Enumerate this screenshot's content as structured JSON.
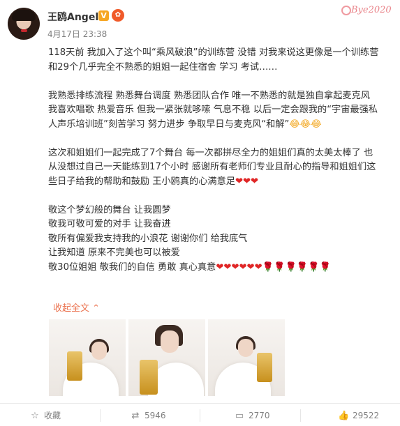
{
  "header": {
    "username": "王鸥Angel",
    "verified_badge": "V",
    "vip_icon": "✿",
    "date": "4月17日 23:38",
    "watermark_text": "Bye2020"
  },
  "post": {
    "paragraphs": [
      [
        "118天前 我加入了这个叫“乘风破浪”的训练营 没错 对我来说这更像是一个训练营",
        "和29个几乎完全不熟悉的姐姐一起住宿舍 学习 考试……"
      ],
      [
        "我熟悉排练流程 熟悉舞台调度 熟悉团队合作 唯一不熟悉的就是独自拿起麦克风",
        "我喜欢唱歌 热爱音乐 但我一紧张就哆嗦 气息不稳 以后一定会跟我的“宇宙最强私",
        "人声乐培训班”刻苦学习 努力进步 争取早日与麦克风“和解”"
      ],
      [
        "这次和姐姐们一起完成了7个舞台 每一次都拼尽全力的姐姐们真的太美太棒了 也",
        "从没想过自己一天能练到17个小时 感谢所有老师们专业且耐心的指导和姐姐们这",
        "些日子给我的帮助和鼓励 王小鸥真的心满意足"
      ],
      [
        "敬这个梦幻般的舞台 让我圆梦",
        "敬我可敬可爱的对手 让我奋进",
        "敬所有偏爱我支持我的小浪花 谢谢你们 给我底气",
        "让我知道 原来不完美也可以被爱",
        "敬30位姐姐 敬我们的自信 勇敢 真心真意"
      ]
    ],
    "laugh_emoji": "😂😂😂",
    "hearts_short": "❤❤❤",
    "hearts_long": "❤❤❤❤❤❤",
    "roses": "🌹🌹🌹🌹🌹🌹",
    "collapse_label": "收起全文 ⌃"
  },
  "actions": {
    "favorite_label": "收藏",
    "repost_count": "5946",
    "comment_count": "2770",
    "like_count": "29522"
  },
  "icons": {
    "favorite": "star-outline-icon",
    "repost": "repost-icon",
    "comment": "comment-icon",
    "like": "thumbs-up-icon"
  },
  "colors": {
    "accent": "#eb7350",
    "text": "#333333",
    "muted": "#808080"
  }
}
